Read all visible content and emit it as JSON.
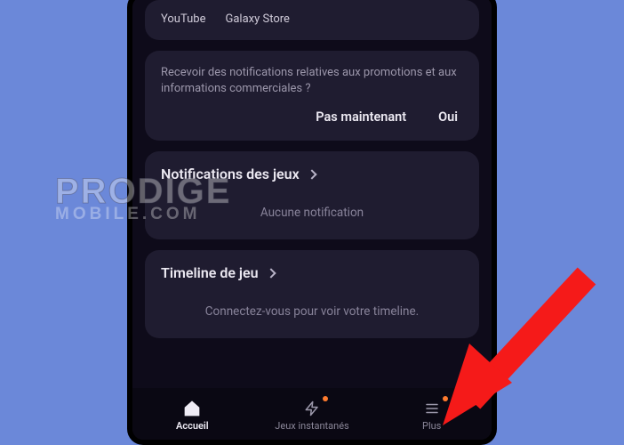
{
  "topcard": {
    "youtube": "YouTube",
    "galaxystore": "Galaxy Store"
  },
  "promo": {
    "text": "Recevoir des notifications relatives aux promotions et aux informations commerciales ?",
    "notnow": "Pas maintenant",
    "yes": "Oui"
  },
  "notifications": {
    "title": "Notifications des jeux",
    "empty": "Aucune notification"
  },
  "timeline": {
    "title": "Timeline de jeu",
    "empty": "Connectez-vous pour voir votre timeline."
  },
  "nav": {
    "home": "Accueil",
    "instant": "Jeux instantanés",
    "more": "Plus"
  },
  "watermark": {
    "line1": "PRODIGE",
    "line2": "MOBILE.COM"
  }
}
